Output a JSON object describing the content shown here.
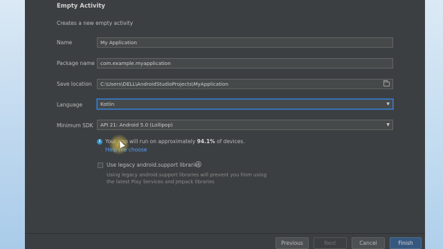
{
  "wizard": {
    "title": "Empty Activity",
    "subtitle": "Creates a new empty activity"
  },
  "form": {
    "name": {
      "label": "Name",
      "value": "My Application"
    },
    "package": {
      "label": "Package name",
      "value": "com.example.myapplication"
    },
    "save_location": {
      "label": "Save location",
      "value": "C:\\Users\\DELL\\AndroidStudioProjects\\MyApplication"
    },
    "language": {
      "label": "Language",
      "value": "Kotlin"
    },
    "min_sdk": {
      "label": "Minimum SDK",
      "value": "API 21: Android 5.0 (Lollipop)"
    }
  },
  "info": {
    "text_prefix": "Your app will run on approximately ",
    "percent": "94.1%",
    "text_suffix": " of devices.",
    "help_link": "Help me choose"
  },
  "legacy": {
    "label": "Use legacy android.support libraries",
    "checked": false,
    "description": "Using legacy android.support libraries will prevent you from using the latest Play Services and Jetpack libraries"
  },
  "buttons": {
    "previous": "Previous",
    "next": "Next",
    "cancel": "Cancel",
    "finish": "Finish"
  },
  "icons": {
    "folder": "folder-icon",
    "dropdown": "chevron-down-icon",
    "info": "info-icon",
    "help": "help-icon"
  },
  "colors": {
    "dialog_bg": "#3c3f41",
    "field_bg": "#45494a",
    "focus_border": "#3d7cc9",
    "link": "#589df6",
    "primary_button": "#365880"
  }
}
